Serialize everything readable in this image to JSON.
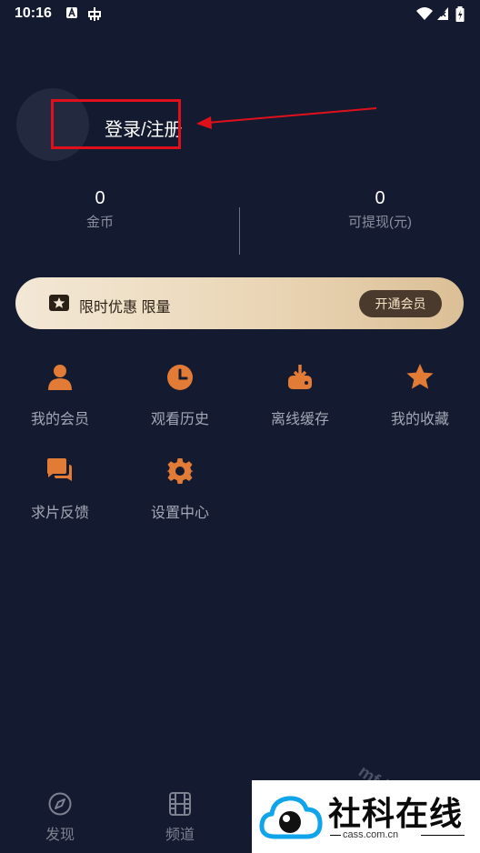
{
  "status_bar": {
    "time": "10:16"
  },
  "profile": {
    "login_label": "登录/注册"
  },
  "stats": [
    {
      "value": "0",
      "label": "金币"
    },
    {
      "value": "0",
      "label": "可提现(元)"
    }
  ],
  "vip_banner": {
    "text": "限时优惠 限量",
    "button_label": "开通会员"
  },
  "grid": [
    {
      "label": "我的会员",
      "icon": "user-icon"
    },
    {
      "label": "观看历史",
      "icon": "clock-icon"
    },
    {
      "label": "离线缓存",
      "icon": "download-icon"
    },
    {
      "label": "我的收藏",
      "icon": "star-icon"
    },
    {
      "label": "求片反馈",
      "icon": "chat-icon"
    },
    {
      "label": "设置中心",
      "icon": "gear-icon"
    }
  ],
  "bottom_nav": [
    {
      "label": "发现",
      "icon": "compass-icon"
    },
    {
      "label": "频道",
      "icon": "film-icon"
    }
  ],
  "watermark": {
    "overlay_text": "mf 魔粉",
    "site_name": "社科在线",
    "site_domain": "cass.com.cn"
  },
  "colors": {
    "background": "#141a30",
    "accent_orange": "#e27b35",
    "highlight_red": "#e0101a"
  }
}
